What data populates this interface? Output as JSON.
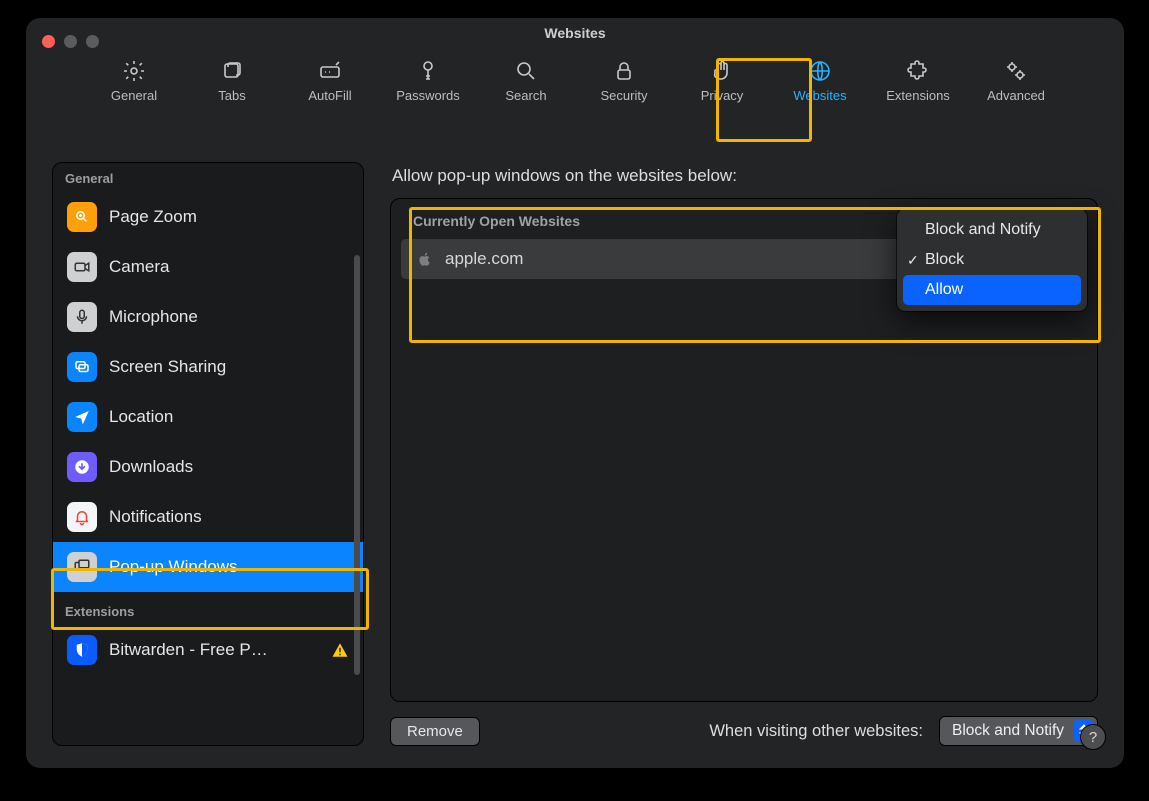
{
  "window": {
    "title": "Websites"
  },
  "toolbar": {
    "items": [
      {
        "id": "general",
        "label": "General"
      },
      {
        "id": "tabs",
        "label": "Tabs"
      },
      {
        "id": "autofill",
        "label": "AutoFill"
      },
      {
        "id": "passwords",
        "label": "Passwords"
      },
      {
        "id": "search",
        "label": "Search"
      },
      {
        "id": "security",
        "label": "Security"
      },
      {
        "id": "privacy",
        "label": "Privacy"
      },
      {
        "id": "websites",
        "label": "Websites",
        "active": true
      },
      {
        "id": "extensions",
        "label": "Extensions"
      },
      {
        "id": "advanced",
        "label": "Advanced"
      }
    ]
  },
  "sidebar": {
    "section1_label": "General",
    "section2_label": "Extensions",
    "items": {
      "page_zoom": "Page Zoom",
      "camera": "Camera",
      "microphone": "Microphone",
      "screen_sharing": "Screen Sharing",
      "location": "Location",
      "downloads": "Downloads",
      "notifications": "Notifications",
      "popup": "Pop-up Windows",
      "bitwarden": "Bitwarden - Free P…"
    },
    "selected": "popup"
  },
  "main": {
    "heading": "Allow pop-up windows on the websites below:",
    "list_header": "Currently Open Websites",
    "rows": [
      {
        "site": "apple.com",
        "value": "Block"
      }
    ],
    "dropdown": {
      "options": [
        "Block and Notify",
        "Block",
        "Allow"
      ],
      "checked": "Block",
      "highlighted": "Allow"
    },
    "remove_label": "Remove",
    "other_label": "When visiting other websites:",
    "other_value": "Block and Notify"
  },
  "help_label": "?"
}
